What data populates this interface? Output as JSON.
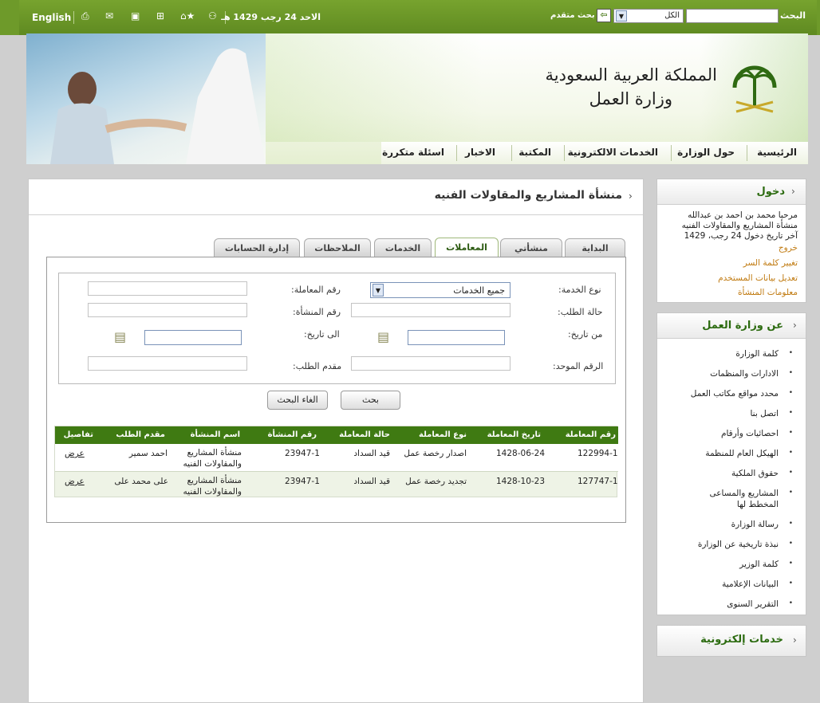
{
  "topbar": {
    "search_label": "البحث",
    "search_value": "",
    "scope_value": "الكل",
    "advanced_search": "بحث متقدم",
    "date_text": "الاحد 24 رجب 1429 هـ",
    "english_link": "English"
  },
  "header": {
    "title_line1": "المملكة العربية السعودية",
    "title_line2": "وزارة العمل"
  },
  "nav": {
    "items": [
      "الرئيسية",
      "حول الوزارة",
      "الخدمات الالكترونية",
      "المكتبة",
      "الاخبار",
      "اسئلة متكررة"
    ]
  },
  "main": {
    "title": "منشأة المشاريع والمقاولات الفنيه",
    "tabs": [
      "البداية",
      "منشأتي",
      "المعاملات",
      "الخدمات",
      "الملاحظات",
      "إدارة الحسابات"
    ],
    "form": {
      "service_type_label": "نوع الخدمة:",
      "service_type_value": "جميع الخدمات",
      "transaction_no_label": "رقم المعاملة:",
      "transaction_no_value": "",
      "request_status_label": "حالة الطلب:",
      "request_status_value": "",
      "facility_no_label": "رقم المنشأة:",
      "facility_no_value": "",
      "from_date_label": "من تاريخ:",
      "from_date_value": "",
      "to_date_label": "الى تاريخ:",
      "to_date_value": "",
      "unified_no_label": "الرقم الموحد:",
      "unified_no_value": "",
      "applicant_label": "مقدم الطلب:",
      "applicant_value": "",
      "search_button": "بحث",
      "cancel_button": "الغاء البحث"
    },
    "table": {
      "headers": [
        "رقم المعاملة",
        "تاريخ المعاملة",
        "نوع المعاملة",
        "حالة المعاملة",
        "رقم المنشأة",
        "اسم المنشأة",
        "مقدم الطلب",
        "تفاصيل"
      ],
      "rows": [
        {
          "no": "122994-1",
          "date": "1428-06-24",
          "type": "اصدار رخصة عمل",
          "status": "قيد السداد",
          "facility_no": "23947-1",
          "facility_name": "منشأة المشاريع والمقاولات الفنيه",
          "applicant": "احمد سمير",
          "details": "عرض"
        },
        {
          "no": "127747-1",
          "date": "1428-10-23",
          "type": "تجديد رخصة عمل",
          "status": "قيد السداد",
          "facility_no": "23947-1",
          "facility_name": "منشأة المشاريع والمقاولات الفنيه",
          "applicant": "على محمد على",
          "details": "عرض"
        }
      ]
    }
  },
  "login_panel": {
    "title": "دخول",
    "welcome": "مرحبا محمد بن احمد بن عبدالله",
    "facility": "منشأة المشاريع والمقاولات الفنيه",
    "last_login": "آخر تاريخ دخول 24 رجب، 1429",
    "logout": "خروج",
    "change_password": "تغيير كلمة السر",
    "edit_user": "تعديل بيانات المستخدم",
    "facility_info": "معلومات المنشأة"
  },
  "about_panel": {
    "title": "عن وزارة العمل",
    "items": [
      "كلمة الوزارة",
      "الادارات والمنظمات",
      "محدد مواقع مكاتب العمل",
      "اتصل بنا",
      "احصائيات وأرقام",
      "الهيكل العام للمنظمة",
      "حقوق الملكية",
      "المشاريع والمساعى المخطط لها",
      "رسالة الوزارة",
      "نبذة تاريخية عن الوزارة",
      "كلمة الوزير",
      "البيانات الإعلامية",
      "التقرير السنوى"
    ]
  },
  "eservices_panel": {
    "title": "خدمات إلكترونية"
  },
  "colors": {
    "brand_green": "#5f8a21",
    "table_header": "#3f7a12",
    "link_orange": "#c07a10"
  }
}
